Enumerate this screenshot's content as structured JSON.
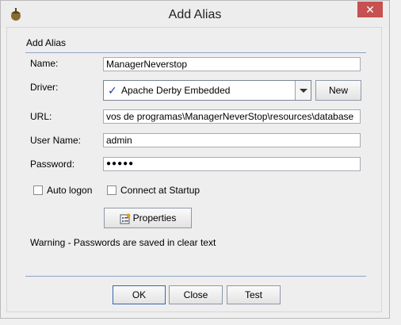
{
  "window": {
    "title": "Add Alias",
    "close_label": "✕"
  },
  "section": {
    "title": "Add Alias"
  },
  "form": {
    "name_label": "Name:",
    "name_value": "ManagerNeverstop",
    "driver_label": "Driver:",
    "driver_value": "Apache Derby Embedded",
    "new_button": "New",
    "url_label": "URL:",
    "url_value": "vos de programas\\ManagerNeverStop\\resources\\database",
    "username_label": "User Name:",
    "username_value": "admin",
    "password_label": "Password:",
    "password_value": "●●●●●",
    "auto_logon_label": "Auto logon",
    "auto_logon_checked": false,
    "connect_startup_label": "Connect at Startup",
    "connect_startup_checked": false,
    "properties_button": "Properties",
    "warning": "Warning - Passwords are saved in clear text"
  },
  "footer": {
    "ok": "OK",
    "close": "Close",
    "test": "Test"
  },
  "colors": {
    "close_button": "#c75050",
    "accent_line": "#8fa3c7",
    "check_mark": "#1d3fb5"
  }
}
